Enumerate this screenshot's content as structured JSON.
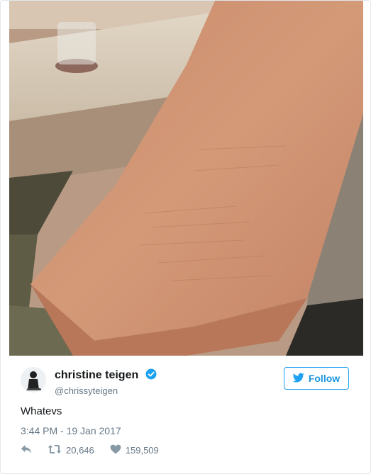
{
  "tweet": {
    "display_name": "christine teigen",
    "handle": "@chrissyteigen",
    "text": "Whatevs",
    "timestamp": "3:44 PM - 19 Jan 2017",
    "follow_label": "Follow",
    "retweet_count": "20,646",
    "like_count": "159,509"
  },
  "icons": {
    "verified": "verified-badge-icon",
    "follow": "bird-icon",
    "reply": "reply-icon",
    "retweet": "retweet-icon",
    "like": "heart-icon"
  },
  "colors": {
    "accent": "#1da1f2",
    "text": "#14171a",
    "muted": "#657786"
  }
}
